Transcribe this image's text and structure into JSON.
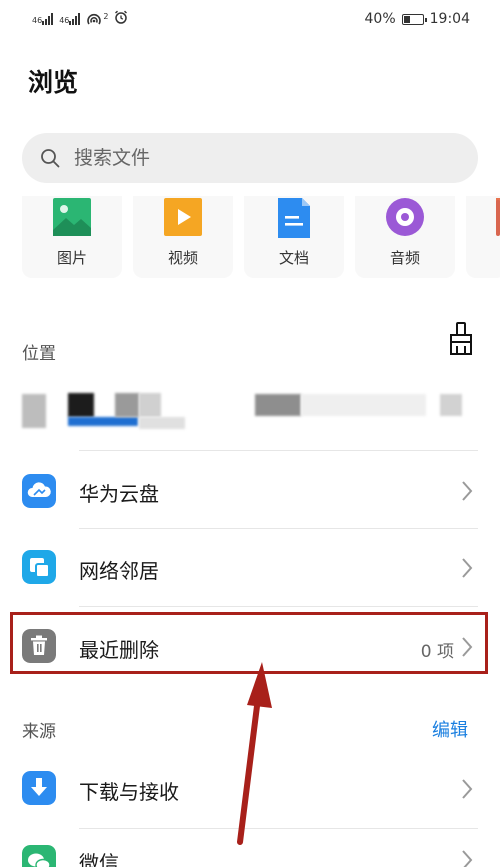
{
  "status_bar": {
    "signal_1": "46",
    "signal_2": "46",
    "hotspot_count": "2",
    "battery_percent": "40%",
    "battery_level": 0.4,
    "time": "19:04",
    "icons": [
      "signal-icon",
      "signal-icon",
      "hotspot-icon",
      "alarm-icon",
      "battery-icon"
    ]
  },
  "page": {
    "title": "浏览"
  },
  "search": {
    "placeholder": "搜索文件"
  },
  "categories": [
    {
      "label": "图片",
      "icon": "image-icon",
      "color": "#2bb673"
    },
    {
      "label": "视频",
      "icon": "video-icon",
      "color": "#f5a623"
    },
    {
      "label": "文档",
      "icon": "document-icon",
      "color": "#2d8cf0"
    },
    {
      "label": "音频",
      "icon": "audio-icon",
      "color": "#9b59d6"
    }
  ],
  "locations": {
    "label": "位置",
    "clean_icon": "broom-icon",
    "items": [
      {
        "label": "华为云盘",
        "icon": "cloud-icon",
        "color": "#2d8cf0"
      },
      {
        "label": "网络邻居",
        "icon": "network-icon",
        "color": "#1fa8e8"
      },
      {
        "label": "最近删除",
        "icon": "trash-icon",
        "color": "#7a7a7a",
        "count": "0 项"
      }
    ]
  },
  "sources": {
    "label": "来源",
    "edit": "编辑",
    "items": [
      {
        "label": "下载与接收",
        "icon": "download-icon",
        "color": "#2d8cf0"
      },
      {
        "label": "微信",
        "icon": "wechat-icon",
        "color": "#2bb673"
      }
    ]
  },
  "colors": {
    "highlight": "#a8201a",
    "accent": "#1a7fe0"
  }
}
